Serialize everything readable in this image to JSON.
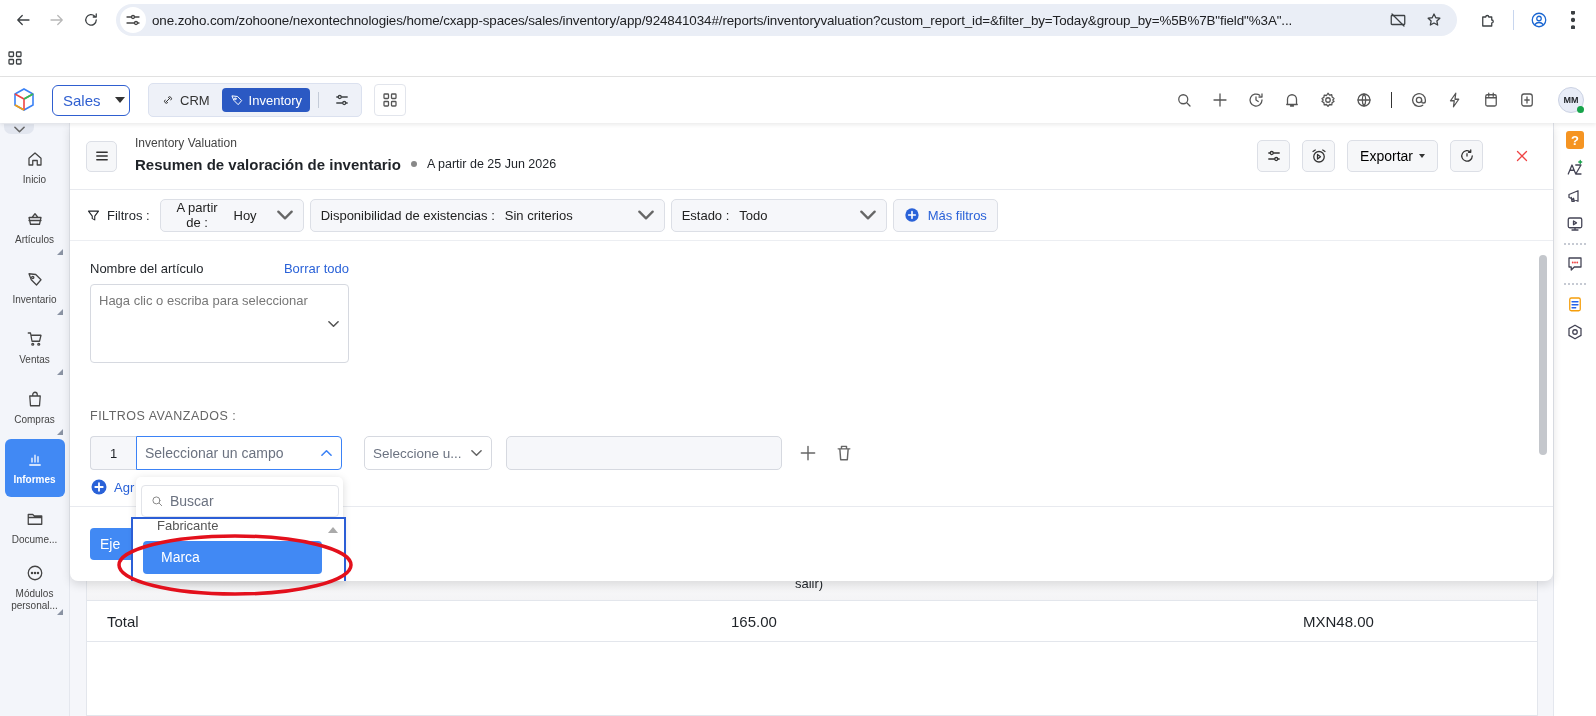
{
  "browser": {
    "url": "one.zoho.com/zohoone/nexontechnologies/home/cxapp-spaces/sales/inventory/app/924841034#/reports/inventoryvaluation?custom_report_id=&filter_by=Today&group_by=%5B%7B\"field\"%3A\"...",
    "forward_disabled": true
  },
  "app_bar": {
    "space": "Sales",
    "apps": [
      {
        "label": "CRM",
        "selected": false
      },
      {
        "label": "Inventory",
        "selected": true
      }
    ],
    "avatar": "MM",
    "online": true
  },
  "sidebar": {
    "items": [
      {
        "label": "Inicio",
        "selected": false,
        "submenu": false
      },
      {
        "label": "Artículos",
        "selected": false,
        "submenu": true
      },
      {
        "label": "Inventario",
        "selected": false,
        "submenu": true
      },
      {
        "label": "Ventas",
        "selected": false,
        "submenu": true
      },
      {
        "label": "Compras",
        "selected": false,
        "submenu": true
      },
      {
        "label": "Informes",
        "selected": true,
        "submenu": false
      },
      {
        "label": "Docume...",
        "selected": false,
        "submenu": false
      },
      {
        "label": "Módulos personal...",
        "selected": false,
        "submenu": true
      }
    ]
  },
  "report": {
    "breadcrumb": "Inventory Valuation",
    "title": "Resumen de valoración de inventario",
    "as_of": "A partir de 25 Jun 2026",
    "export": "Exportar"
  },
  "filters": {
    "label": "Filtros :",
    "items": [
      {
        "label": "A partir de :",
        "value": "Hoy"
      },
      {
        "label": "Disponibilidad de existencias :",
        "value": "Sin criterios"
      },
      {
        "label": "Estado :",
        "value": "Todo"
      }
    ],
    "more": "Más filtros"
  },
  "item_name": {
    "label": "Nombre del artículo",
    "clear": "Borrar todo",
    "placeholder": "Haga clic o escriba para seleccionar"
  },
  "advanced": {
    "heading": "FILTROS AVANZADOS :",
    "rows": [
      {
        "number": "1",
        "field_placeholder": "Seleccionar un campo",
        "expanded": true,
        "operator_placeholder": "Seleccione u..."
      }
    ],
    "add": "Agr",
    "run": "Eje"
  },
  "dropdown": {
    "search_placeholder": "Buscar",
    "options": [
      {
        "label": "Fabricante",
        "selected": false
      },
      {
        "label": "Marca",
        "selected": true
      }
    ]
  },
  "annotation": {
    "kind": "ellipse"
  },
  "right_sidebar": {
    "help": "?"
  },
  "table": {
    "header_fragment": "salir)",
    "total": {
      "label": "Total",
      "quantity": "165.00",
      "value": "MXN48.00"
    }
  }
}
